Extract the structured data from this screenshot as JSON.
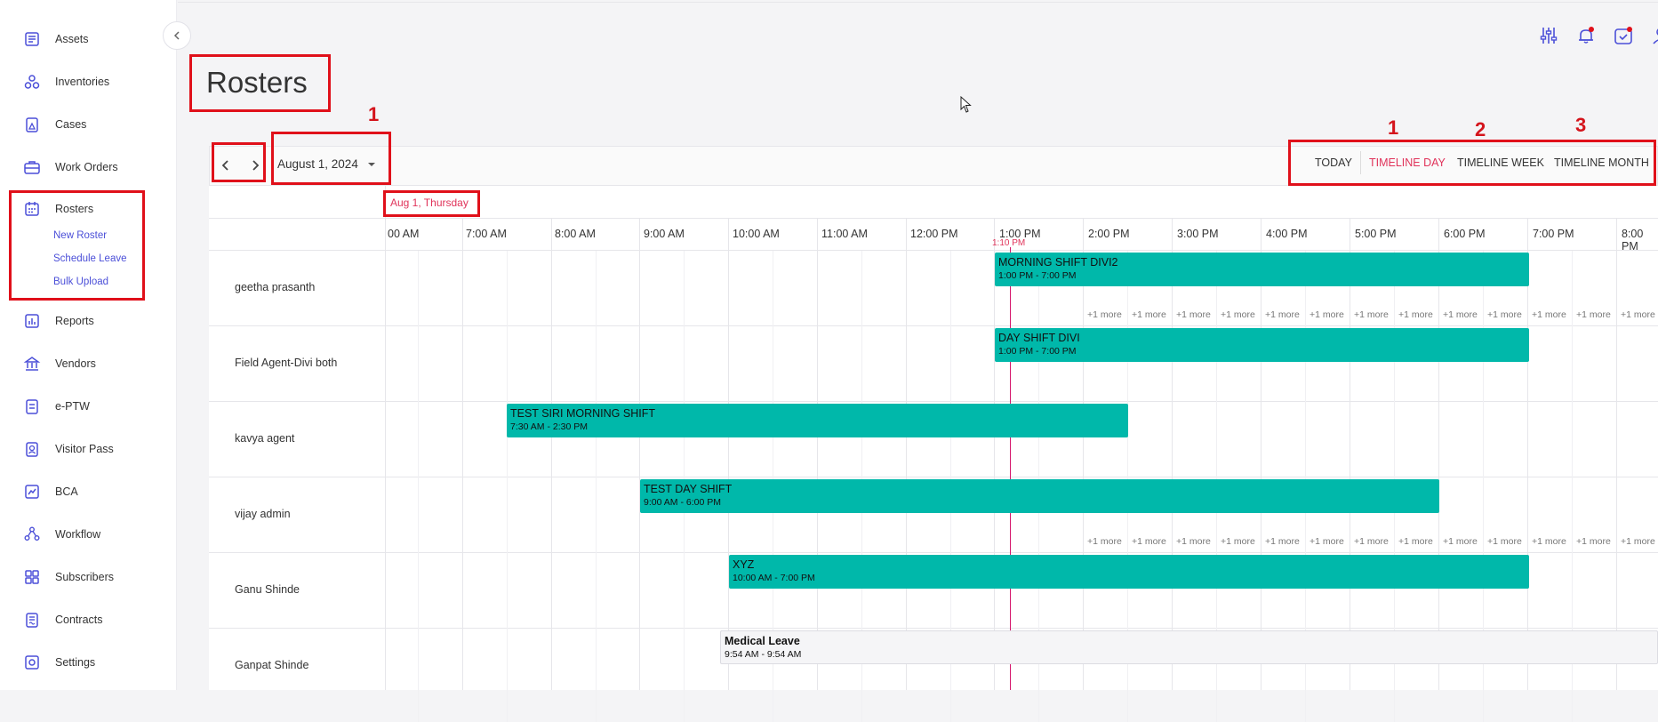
{
  "sidebar": {
    "items": [
      {
        "label": "Assets",
        "icon": "assets-icon"
      },
      {
        "label": "Inventories",
        "icon": "inventories-icon"
      },
      {
        "label": "Cases",
        "icon": "cases-icon"
      },
      {
        "label": "Work Orders",
        "icon": "work-orders-icon"
      },
      {
        "label": "Rosters",
        "icon": "rosters-icon"
      },
      {
        "label": "Reports",
        "icon": "reports-icon"
      },
      {
        "label": "Vendors",
        "icon": "vendors-icon"
      },
      {
        "label": "e-PTW",
        "icon": "eptw-icon"
      },
      {
        "label": "Visitor Pass",
        "icon": "visitor-pass-icon"
      },
      {
        "label": "BCA",
        "icon": "bca-icon"
      },
      {
        "label": "Workflow",
        "icon": "workflow-icon"
      },
      {
        "label": "Subscribers",
        "icon": "subscribers-icon"
      },
      {
        "label": "Contracts",
        "icon": "contracts-icon"
      },
      {
        "label": "Settings",
        "icon": "settings-icon"
      }
    ],
    "rosters_sub": [
      "New Roster",
      "Schedule Leave",
      "Bulk Upload"
    ]
  },
  "page": {
    "title": "Rosters"
  },
  "toolbar": {
    "date": "August 1, 2024",
    "today": "TODAY",
    "views": [
      "TIMELINE DAY",
      "TIMELINE WEEK",
      "TIMELINE MONTH"
    ],
    "active_view": "TIMELINE DAY"
  },
  "annotations": [
    "1",
    "1",
    "2",
    "3"
  ],
  "scheduler": {
    "date_label": "Aug 1, Thursday",
    "hours": [
      "00 AM",
      "7:00 AM",
      "8:00 AM",
      "9:00 AM",
      "10:00 AM",
      "11:00 AM",
      "12:00 PM",
      "1:00 PM",
      "2:00 PM",
      "3:00 PM",
      "4:00 PM",
      "5:00 PM",
      "6:00 PM",
      "7:00 PM",
      "8:00 PM"
    ],
    "now_label": "1:10 PM",
    "resources": [
      "geetha prasanth",
      "Field Agent-Divi both",
      "kavya agent",
      "vijay admin",
      "Ganu Shinde",
      "Ganpat Shinde"
    ],
    "events": [
      {
        "title": "MORNING SHIFT DIVI2",
        "time": "1:00 PM - 7:00 PM"
      },
      {
        "title": "DAY SHIFT DIVI",
        "time": "1:00 PM - 7:00 PM"
      },
      {
        "title": "TEST SIRI MORNING SHIFT",
        "time": "7:30 AM - 2:30 PM"
      },
      {
        "title": "TEST DAY SHIFT",
        "time": "9:00 AM - 6:00 PM"
      },
      {
        "title": "XYZ",
        "time": "10:00 AM - 7:00 PM"
      },
      {
        "title": "Medical Leave",
        "time": "9:54 AM - 9:54 AM"
      }
    ],
    "more_label": "+1 more"
  },
  "colors": {
    "accent": "#00b8aa",
    "active_view": "#e0335a",
    "link": "#4b4fd8",
    "annotation": "#e0101a"
  }
}
